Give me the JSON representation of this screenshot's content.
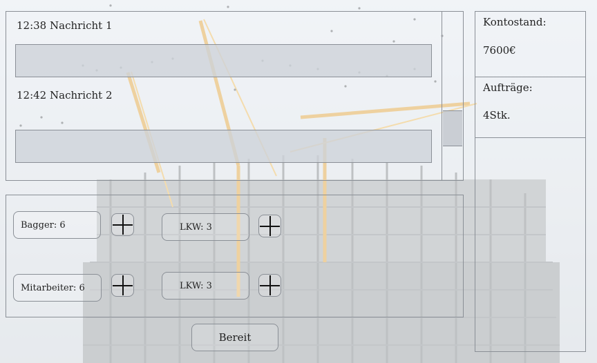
{
  "messages": [
    {
      "title": "12:38 Nachricht 1",
      "body": ""
    },
    {
      "title": "12:42 Nachricht 2",
      "body": ""
    }
  ],
  "side": {
    "balance_label": "Kontostand:",
    "balance_value": "7600€",
    "orders_label": "Aufträge:",
    "orders_value": "4Stk."
  },
  "resources": {
    "bagger": "Bagger: 6",
    "mitarbeiter": "Mitarbeiter: 6",
    "lkw_top": "LKW: 3",
    "lkw_bottom": "LKW: 3"
  },
  "ready_label": "Bereit",
  "icons": {
    "plus": "plus-icon"
  }
}
